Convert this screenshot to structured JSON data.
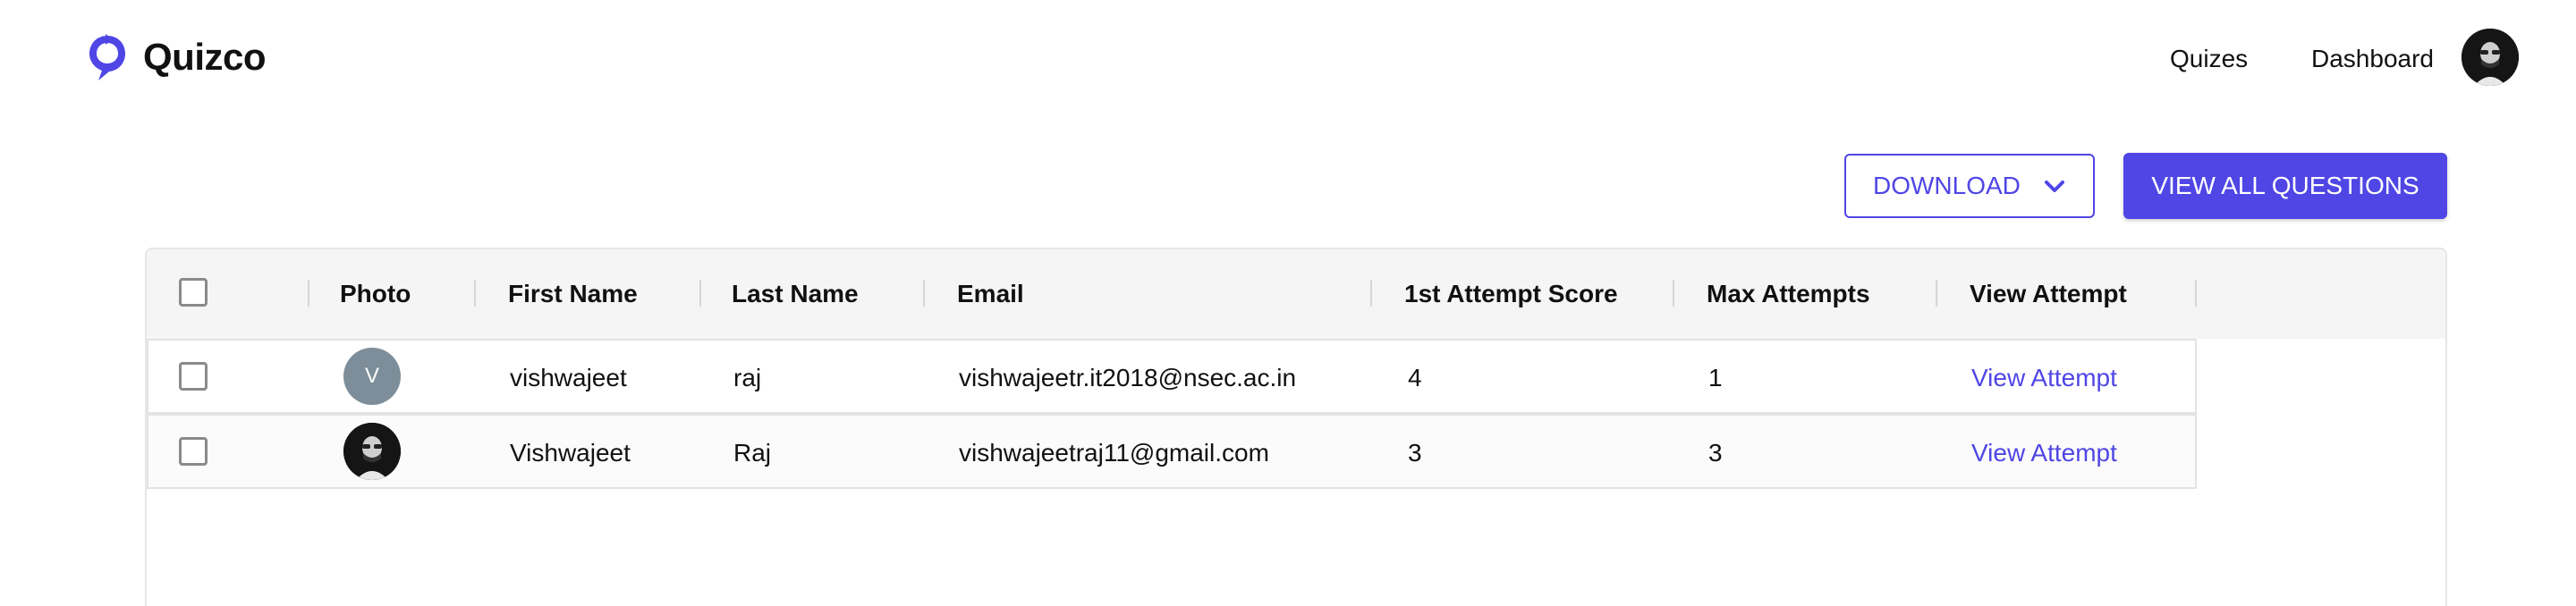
{
  "brand": {
    "name": "Quizco",
    "color": "#4f46e5"
  },
  "nav": {
    "quizes": "Quizes",
    "dashboard": "Dashboard"
  },
  "toolbar": {
    "download_label": "DOWNLOAD",
    "view_all_label": "VIEW ALL QUESTIONS"
  },
  "table": {
    "columns": {
      "photo": "Photo",
      "first_name": "First Name",
      "last_name": "Last Name",
      "email": "Email",
      "first_attempt_score": "1st Attempt Score",
      "max_attempts": "Max Attempts",
      "view_attempt": "View Attempt"
    },
    "rows": [
      {
        "photo_initial": "V",
        "first_name": "vishwajeet",
        "last_name": "raj",
        "email": "vishwajeetr.it2018@nsec.ac.in",
        "first_attempt_score": "4",
        "max_attempts": "1",
        "view_attempt": "View Attempt"
      },
      {
        "photo_initial": "",
        "first_name": "Vishwajeet",
        "last_name": "Raj",
        "email": "vishwajeetraj11@gmail.com",
        "first_attempt_score": "3",
        "max_attempts": "3",
        "view_attempt": "View Attempt"
      }
    ]
  }
}
